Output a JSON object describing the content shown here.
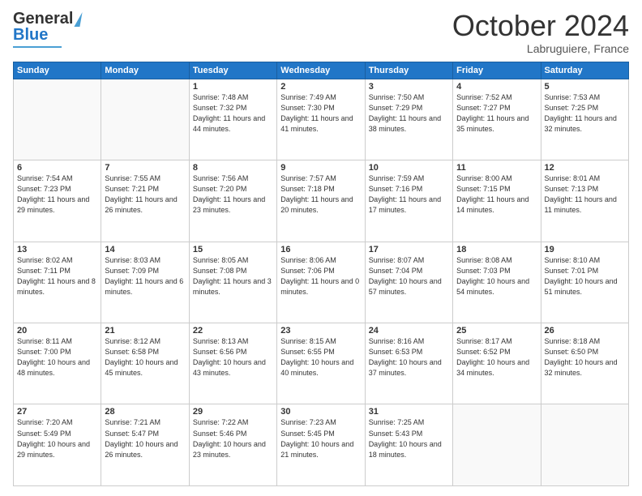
{
  "header": {
    "logo_line1": "General",
    "logo_line2": "Blue",
    "month": "October 2024",
    "location": "Labruguiere, France"
  },
  "weekdays": [
    "Sunday",
    "Monday",
    "Tuesday",
    "Wednesday",
    "Thursday",
    "Friday",
    "Saturday"
  ],
  "weeks": [
    [
      {
        "day": "",
        "detail": ""
      },
      {
        "day": "",
        "detail": ""
      },
      {
        "day": "1",
        "detail": "Sunrise: 7:48 AM\nSunset: 7:32 PM\nDaylight: 11 hours and 44 minutes."
      },
      {
        "day": "2",
        "detail": "Sunrise: 7:49 AM\nSunset: 7:30 PM\nDaylight: 11 hours and 41 minutes."
      },
      {
        "day": "3",
        "detail": "Sunrise: 7:50 AM\nSunset: 7:29 PM\nDaylight: 11 hours and 38 minutes."
      },
      {
        "day": "4",
        "detail": "Sunrise: 7:52 AM\nSunset: 7:27 PM\nDaylight: 11 hours and 35 minutes."
      },
      {
        "day": "5",
        "detail": "Sunrise: 7:53 AM\nSunset: 7:25 PM\nDaylight: 11 hours and 32 minutes."
      }
    ],
    [
      {
        "day": "6",
        "detail": "Sunrise: 7:54 AM\nSunset: 7:23 PM\nDaylight: 11 hours and 29 minutes."
      },
      {
        "day": "7",
        "detail": "Sunrise: 7:55 AM\nSunset: 7:21 PM\nDaylight: 11 hours and 26 minutes."
      },
      {
        "day": "8",
        "detail": "Sunrise: 7:56 AM\nSunset: 7:20 PM\nDaylight: 11 hours and 23 minutes."
      },
      {
        "day": "9",
        "detail": "Sunrise: 7:57 AM\nSunset: 7:18 PM\nDaylight: 11 hours and 20 minutes."
      },
      {
        "day": "10",
        "detail": "Sunrise: 7:59 AM\nSunset: 7:16 PM\nDaylight: 11 hours and 17 minutes."
      },
      {
        "day": "11",
        "detail": "Sunrise: 8:00 AM\nSunset: 7:15 PM\nDaylight: 11 hours and 14 minutes."
      },
      {
        "day": "12",
        "detail": "Sunrise: 8:01 AM\nSunset: 7:13 PM\nDaylight: 11 hours and 11 minutes."
      }
    ],
    [
      {
        "day": "13",
        "detail": "Sunrise: 8:02 AM\nSunset: 7:11 PM\nDaylight: 11 hours and 8 minutes."
      },
      {
        "day": "14",
        "detail": "Sunrise: 8:03 AM\nSunset: 7:09 PM\nDaylight: 11 hours and 6 minutes."
      },
      {
        "day": "15",
        "detail": "Sunrise: 8:05 AM\nSunset: 7:08 PM\nDaylight: 11 hours and 3 minutes."
      },
      {
        "day": "16",
        "detail": "Sunrise: 8:06 AM\nSunset: 7:06 PM\nDaylight: 11 hours and 0 minutes."
      },
      {
        "day": "17",
        "detail": "Sunrise: 8:07 AM\nSunset: 7:04 PM\nDaylight: 10 hours and 57 minutes."
      },
      {
        "day": "18",
        "detail": "Sunrise: 8:08 AM\nSunset: 7:03 PM\nDaylight: 10 hours and 54 minutes."
      },
      {
        "day": "19",
        "detail": "Sunrise: 8:10 AM\nSunset: 7:01 PM\nDaylight: 10 hours and 51 minutes."
      }
    ],
    [
      {
        "day": "20",
        "detail": "Sunrise: 8:11 AM\nSunset: 7:00 PM\nDaylight: 10 hours and 48 minutes."
      },
      {
        "day": "21",
        "detail": "Sunrise: 8:12 AM\nSunset: 6:58 PM\nDaylight: 10 hours and 45 minutes."
      },
      {
        "day": "22",
        "detail": "Sunrise: 8:13 AM\nSunset: 6:56 PM\nDaylight: 10 hours and 43 minutes."
      },
      {
        "day": "23",
        "detail": "Sunrise: 8:15 AM\nSunset: 6:55 PM\nDaylight: 10 hours and 40 minutes."
      },
      {
        "day": "24",
        "detail": "Sunrise: 8:16 AM\nSunset: 6:53 PM\nDaylight: 10 hours and 37 minutes."
      },
      {
        "day": "25",
        "detail": "Sunrise: 8:17 AM\nSunset: 6:52 PM\nDaylight: 10 hours and 34 minutes."
      },
      {
        "day": "26",
        "detail": "Sunrise: 8:18 AM\nSunset: 6:50 PM\nDaylight: 10 hours and 32 minutes."
      }
    ],
    [
      {
        "day": "27",
        "detail": "Sunrise: 7:20 AM\nSunset: 5:49 PM\nDaylight: 10 hours and 29 minutes."
      },
      {
        "day": "28",
        "detail": "Sunrise: 7:21 AM\nSunset: 5:47 PM\nDaylight: 10 hours and 26 minutes."
      },
      {
        "day": "29",
        "detail": "Sunrise: 7:22 AM\nSunset: 5:46 PM\nDaylight: 10 hours and 23 minutes."
      },
      {
        "day": "30",
        "detail": "Sunrise: 7:23 AM\nSunset: 5:45 PM\nDaylight: 10 hours and 21 minutes."
      },
      {
        "day": "31",
        "detail": "Sunrise: 7:25 AM\nSunset: 5:43 PM\nDaylight: 10 hours and 18 minutes."
      },
      {
        "day": "",
        "detail": ""
      },
      {
        "day": "",
        "detail": ""
      }
    ]
  ]
}
